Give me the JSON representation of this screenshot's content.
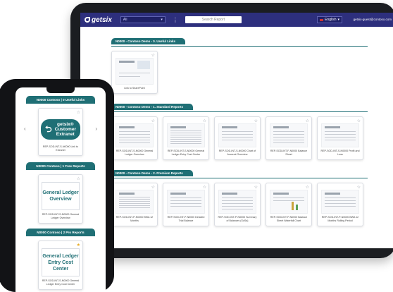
{
  "tablet": {
    "logo": "getsix",
    "org_select": "Ali",
    "search_placeholder": "Search Report",
    "language": "English",
    "user": "getsix-guest@contoso.com",
    "sections": [
      {
        "title": "N0000 - Contoso Demo - 0. Useful Links",
        "cards": [
          {
            "label": "Link to SharePoint"
          }
        ]
      },
      {
        "title": "N0000 - Contoso Demo - 1. Standard Reports",
        "cards": [
          {
            "label": "REP-SOD-INT-S-N0000 General Ledger Overview"
          },
          {
            "label": "REP-SOD-INT-S-N0000 General Ledger Entry Cost Center"
          },
          {
            "label": "REP-SOD-INT-S-N0000 Chart of Account Overview"
          },
          {
            "label": "REP-SOD-INT-F-N0000 Balance Sheet"
          },
          {
            "label": "REP-SOD-INT-S-N0000 Profit and Loss"
          }
        ]
      },
      {
        "title": "N0000 - Contoso Demo - 2. Premium Reports",
        "cards": [
          {
            "label": "REP-SOD-INT-P-N0000 BWA 12 Months"
          },
          {
            "label": "REP-SOD-INT-P-N0000 Detailed Trial Balance"
          },
          {
            "label": "REP-SOD-INT-P-N0000 Summary of Balances (SuSa)"
          },
          {
            "label": "REP-SOD-INT-P-N0000 Balance Sheet Waterfall Chart"
          },
          {
            "label": "REP-SOD-INT-P-N0000 BWA 12 Months Rolling Period"
          }
        ]
      }
    ]
  },
  "phone": {
    "sections": [
      {
        "title": "N0000 Contoso | 0 Useful Links",
        "card_title_lines": [
          "getsix®",
          "Customer",
          "Extranet"
        ],
        "card_label": "REP-SOD-INT-S-N0000 Link to Extranet"
      },
      {
        "title": "N0000 Contoso | 1 Free Reports",
        "card_title_lines": [
          "General Ledger",
          "Overview"
        ],
        "card_label": "REP-SOD-INT-S-N0000 General Ledger Overview"
      },
      {
        "title": "N0000 Contoso | 2 Pro Reports",
        "card_title_lines": [
          "General Ledger",
          "Entry Cost Center"
        ],
        "card_label": "REP-SOD-INT-S-N0000 General Ledger Entry Cost Center"
      }
    ]
  },
  "colors": {
    "topbar": "#2d2f7d",
    "section_teal": "#1f6f75",
    "device_frame": "#1b1d21"
  },
  "icons": {
    "star": "☆",
    "chevron_right": "›",
    "chevron_left": "‹"
  }
}
